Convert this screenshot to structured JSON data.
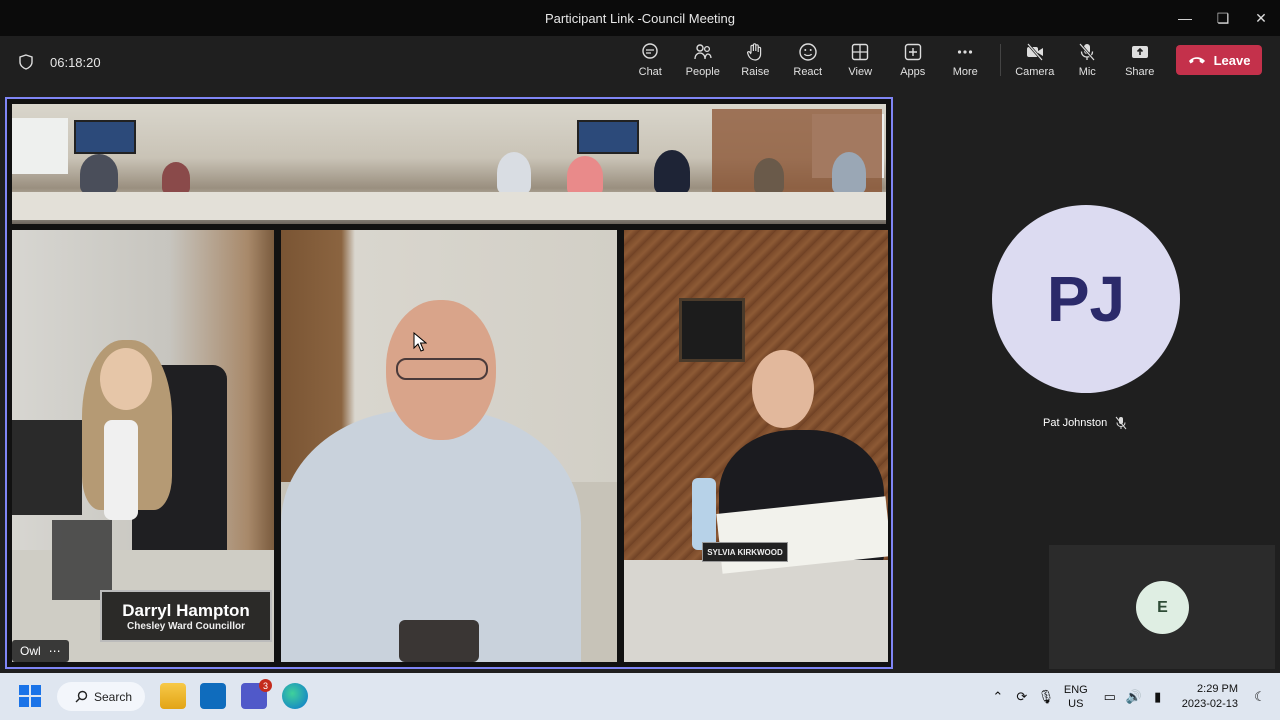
{
  "window": {
    "title": "Participant Link -Council Meeting"
  },
  "meeting": {
    "elapsed": "06:18:20",
    "toolbar": [
      {
        "label": "Chat",
        "icon": "chat-icon"
      },
      {
        "label": "People",
        "icon": "people-icon"
      },
      {
        "label": "Raise",
        "icon": "raise-hand-icon"
      },
      {
        "label": "React",
        "icon": "react-icon"
      },
      {
        "label": "View",
        "icon": "view-icon"
      },
      {
        "label": "Apps",
        "icon": "apps-icon"
      },
      {
        "label": "More",
        "icon": "more-icon"
      },
      {
        "label": "Camera",
        "icon": "camera-off-icon"
      },
      {
        "label": "Mic",
        "icon": "mic-off-icon"
      },
      {
        "label": "Share",
        "icon": "share-icon"
      }
    ],
    "leave_label": "Leave",
    "accent": "#7f85f5",
    "leave_color": "#c4314b"
  },
  "video": {
    "nameplate_name": "Darryl Hampton",
    "nameplate_title": "Chesley Ward Councillor",
    "nameplate_2": "SYLVIA KIRKWOOD",
    "source_label": "Owl"
  },
  "participants": [
    {
      "initials": "PJ",
      "name": "Pat Johnston",
      "muted": true
    },
    {
      "initials": "E"
    }
  ],
  "taskbar": {
    "search_label": "Search",
    "teams_badge": "3",
    "lang_1": "ENG",
    "lang_2": "US",
    "time": "2:29 PM",
    "date": "2023-02-13"
  }
}
